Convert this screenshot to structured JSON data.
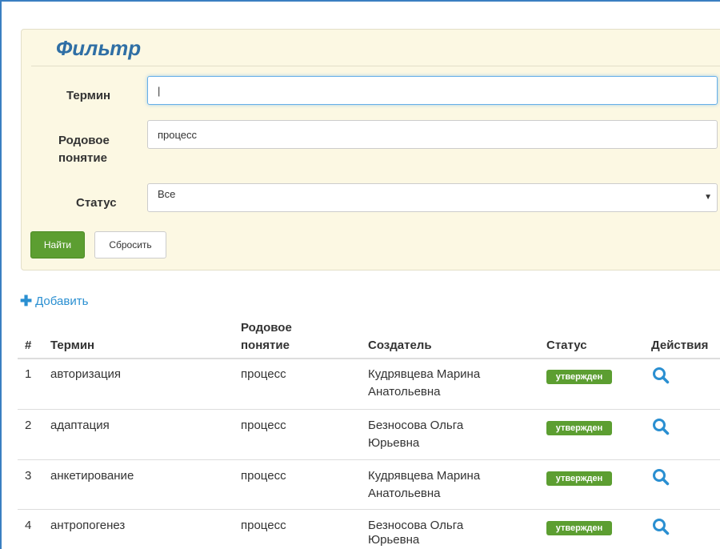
{
  "filter": {
    "title": "Фильтр",
    "term_label": "Термин",
    "term_value": "|",
    "genus_label_line1": "Родовое",
    "genus_label_line2": "понятие",
    "genus_value": "процесс",
    "status_label": "Статус",
    "status_selected": "Все",
    "find_button": "Найти",
    "reset_button": "Сбросить"
  },
  "add_link": "Добавить",
  "table": {
    "headers": {
      "num": "#",
      "term": "Термин",
      "genus_line1": "Родовое",
      "genus_line2": "понятие",
      "creator": "Создатель",
      "status": "Статус",
      "actions": "Действия"
    },
    "rows": [
      {
        "num": "1",
        "term": "авторизация",
        "genus": "процесс",
        "creator_line1": "Кудрявцева Марина",
        "creator_line2": "Анатольевна",
        "status": "утвержден"
      },
      {
        "num": "2",
        "term": "адаптация",
        "genus": "процесс",
        "creator_line1": "Безносова Ольга",
        "creator_line2": "Юрьевна",
        "status": "утвержден"
      },
      {
        "num": "3",
        "term": "анкетирование",
        "genus": "процесс",
        "creator_line1": "Кудрявцева Марина",
        "creator_line2": "Анатольевна",
        "status": "утвержден"
      },
      {
        "num": "4",
        "term": "антропогенез",
        "genus": "процесс",
        "creator_line1": "Безносова Ольга",
        "creator_line2": "Юрьевна",
        "status": "утвержден"
      }
    ]
  },
  "colors": {
    "accent_blue": "#2a8fd1",
    "success_green": "#5c9e31",
    "filter_bg": "#fcf8e3"
  },
  "icons": {
    "add": "plus-icon",
    "view": "search-icon",
    "select": "chevron-down-icon"
  }
}
